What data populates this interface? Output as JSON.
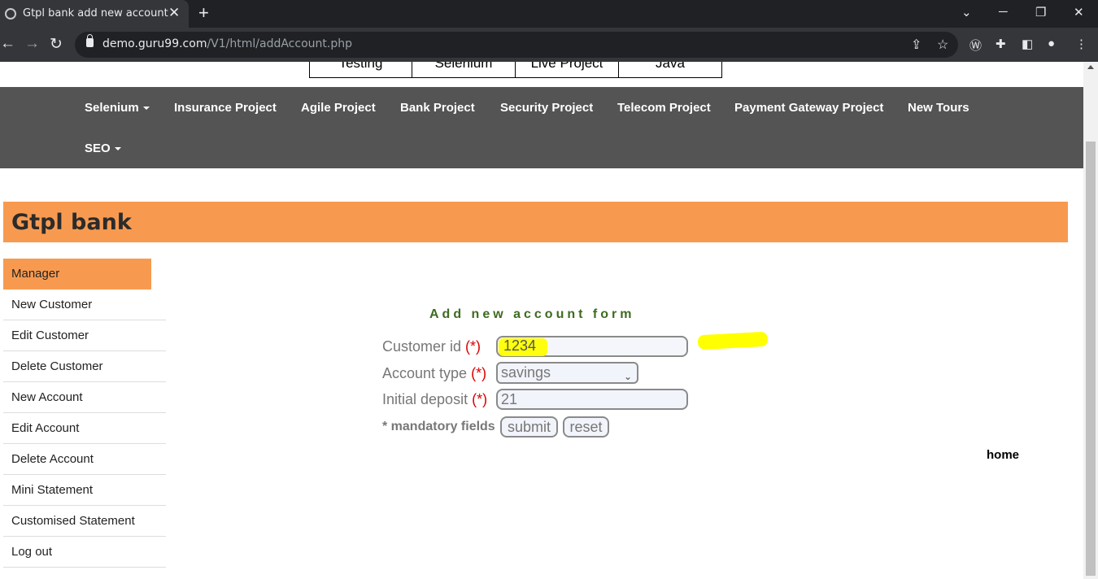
{
  "browser": {
    "tab_title": "Gtpl bank add new account",
    "tab_close": "✕",
    "new_tab": "+",
    "url_host": "demo.guru99.com",
    "url_path": "/V1/html/addAccount.php",
    "window_minimize": "─",
    "window_restore": "❐",
    "window_close": "✕",
    "window_dropdown": "⌄"
  },
  "top_menu": [
    "Testing",
    "Selenium",
    "Live Project",
    "Java"
  ],
  "navbar": {
    "items": [
      "Selenium",
      "Insurance Project",
      "Agile Project",
      "Bank Project",
      "Security Project",
      "Telecom Project",
      "Payment Gateway Project",
      "New Tours",
      "SEO"
    ]
  },
  "header": {
    "title": "Gtpl bank"
  },
  "sidebar": {
    "items": [
      "Manager",
      "New Customer",
      "Edit Customer",
      "Delete Customer",
      "New Account",
      "Edit Account",
      "Delete Account",
      "Mini Statement",
      "Customised Statement",
      "Log out"
    ]
  },
  "form": {
    "title": "Add new account form",
    "customer_id_label": "Customer id",
    "account_type_label": "Account type",
    "initial_deposit_label": "Initial deposit",
    "required_marker": "(*)",
    "customer_id_value": "1234",
    "account_type_value": "savings",
    "initial_deposit_value": "21",
    "mandatory_note": "* mandatory fields",
    "submit_label": "submit",
    "reset_label": "reset"
  },
  "home_link": "home",
  "colors": {
    "header_orange": "#f79a50",
    "navbar_gray": "#545454",
    "form_title_green": "#3e6b1f",
    "highlight_yellow": "#ffff00"
  }
}
